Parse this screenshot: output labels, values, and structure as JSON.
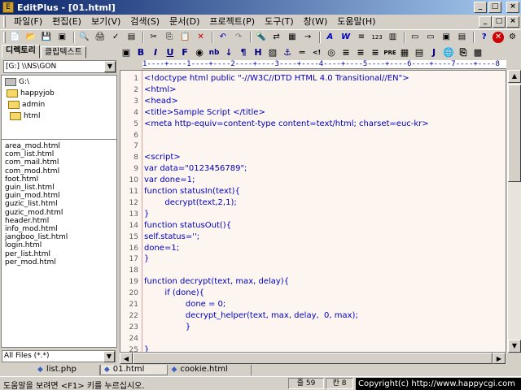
{
  "window": {
    "title": "EditPlus - [01.html]"
  },
  "menu": [
    "파일(F)",
    "편집(E)",
    "보기(V)",
    "검색(S)",
    "문서(D)",
    "프로젝트(P)",
    "도구(T)",
    "창(W)",
    "도움말(H)"
  ],
  "left_panel": {
    "tabs": [
      "디렉토리",
      "클립텍스트"
    ],
    "drive": "[G:] \\\\NS\\GON",
    "tree": [
      "G:\\",
      "happyjob",
      "admin",
      "html"
    ],
    "files": [
      "area_mod.html",
      "com_list.html",
      "com_mail.html",
      "com_mod.html",
      "foot.html",
      "guin_list.html",
      "guin_mod.html",
      "guzic_list.html",
      "guzic_mod.html",
      "header.html",
      "info_mod.html",
      "jangboo_list.html",
      "login.html",
      "per_list.html",
      "per_mod.html"
    ],
    "filter": "All Files (*.*)"
  },
  "ruler": "1----+----1----+----2----+----3----+----4----+----5----+----6----+----7----+----8",
  "code_lines": [
    {
      "n": "1",
      "t": "<!doctype html public \"-//W3C//DTD HTML 4.0 Transitional//EN\">"
    },
    {
      "n": "2",
      "t": "<html>"
    },
    {
      "n": "3",
      "t": "<head>"
    },
    {
      "n": "4",
      "t": "<title>Sample Script </title>"
    },
    {
      "n": "5",
      "t": "<meta http-equiv=content-type content=text/html; charset=euc-kr>"
    },
    {
      "n": "6",
      "t": ""
    },
    {
      "n": "7",
      "t": ""
    },
    {
      "n": "8",
      "t": "<script>"
    },
    {
      "n": "9",
      "t": "var data=\"0123456789\";"
    },
    {
      "n": "10",
      "t": "var done=1;"
    },
    {
      "n": "11",
      "t": "function statusIn(text){"
    },
    {
      "n": "12",
      "t": "        decrypt(text,2,1);"
    },
    {
      "n": "13",
      "t": "}"
    },
    {
      "n": "14",
      "t": "function statusOut(){"
    },
    {
      "n": "15",
      "t": "self.status='';"
    },
    {
      "n": "16",
      "t": "done=1;"
    },
    {
      "n": "17",
      "t": "}"
    },
    {
      "n": "18",
      "t": ""
    },
    {
      "n": "19",
      "t": "function decrypt(text, max, delay){"
    },
    {
      "n": "20",
      "t": "        if (done){"
    },
    {
      "n": "21",
      "t": "                done = 0;"
    },
    {
      "n": "22",
      "t": "                decrypt_helper(text, max, delay,  0, max);"
    },
    {
      "n": "23",
      "t": "                }"
    },
    {
      "n": "24",
      "t": ""
    },
    {
      "n": "25",
      "t": "}"
    }
  ],
  "doc_tabs": [
    "list.php",
    "01.html",
    "cookie.html"
  ],
  "status": {
    "message": "도움말을 보려면 <F1> 키를 누르십시오.",
    "line": "줄 59",
    "col": "칸 8",
    "copyright": "Copyright(c) http://www.happycgi.com"
  }
}
